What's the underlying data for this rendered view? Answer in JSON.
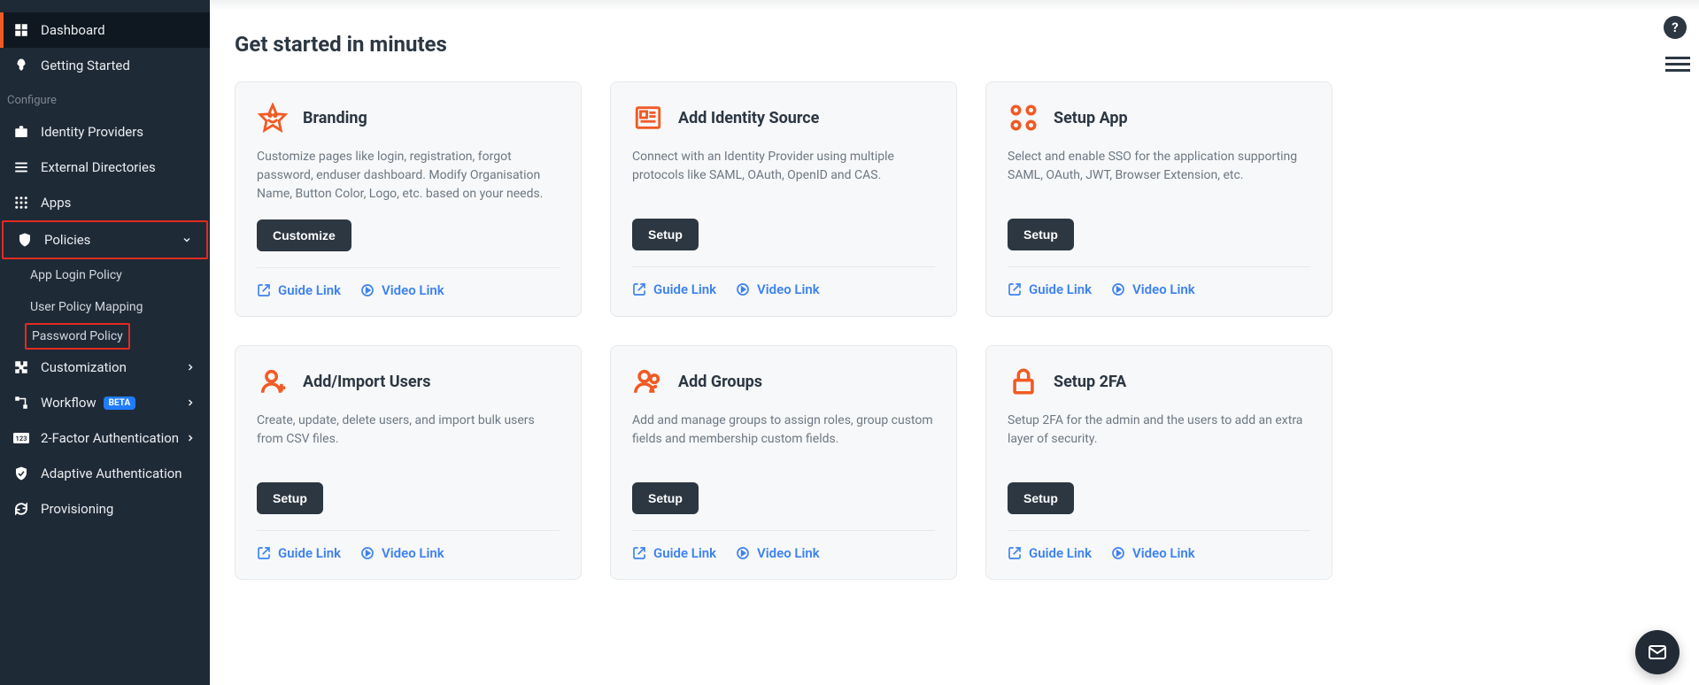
{
  "sidebar": {
    "top": [
      {
        "label": "Dashboard",
        "icon": "dashboard",
        "active": true
      },
      {
        "label": "Getting Started",
        "icon": "rocket"
      }
    ],
    "section_label": "Configure",
    "items": [
      {
        "label": "Identity Providers",
        "icon": "briefcase"
      },
      {
        "label": "External Directories",
        "icon": "list"
      },
      {
        "label": "Apps",
        "icon": "grid"
      },
      {
        "label": "Policies",
        "icon": "shield",
        "expandable": true,
        "outlined": true,
        "children": [
          {
            "label": "App Login Policy"
          },
          {
            "label": "User Policy Mapping"
          },
          {
            "label": "Password Policy",
            "highlighted": true
          }
        ]
      },
      {
        "label": "Customization",
        "icon": "puzzle",
        "expandable": true
      },
      {
        "label": "Workflow",
        "icon": "workflow",
        "badge": "BETA",
        "expandable": true
      },
      {
        "label": "2-Factor Authentication",
        "icon": "digits",
        "expandable": true
      },
      {
        "label": "Adaptive Authentication",
        "icon": "shield-check"
      },
      {
        "label": "Provisioning",
        "icon": "sync"
      }
    ]
  },
  "page": {
    "title": "Get started in minutes",
    "guide_link_label": "Guide Link",
    "video_link_label": "Video Link",
    "cards": [
      {
        "title": "Branding",
        "desc": "Customize pages like login, registration, forgot password, enduser dashboard. Modify Organisation Name, Button Color, Logo, etc. based on your needs.",
        "button": "Customize",
        "icon": "star"
      },
      {
        "title": "Add Identity Source",
        "desc": "Connect with an Identity Provider using multiple protocols like SAML, OAuth, OpenID and CAS.",
        "button": "Setup",
        "icon": "id-card"
      },
      {
        "title": "Setup App",
        "desc": "Select and enable SSO for the application supporting SAML, OAuth, JWT, Browser Extension, etc.",
        "button": "Setup",
        "icon": "apps"
      },
      {
        "title": "Add/Import Users",
        "desc": "Create, update, delete users, and import bulk users from CSV files.",
        "button": "Setup",
        "icon": "user-plus"
      },
      {
        "title": "Add Groups",
        "desc": "Add and manage groups to assign roles, group custom fields and membership custom fields.",
        "button": "Setup",
        "icon": "group"
      },
      {
        "title": "Setup 2FA",
        "desc": "Setup 2FA for the admin and the users to add an extra layer of security.",
        "button": "Setup",
        "icon": "lock"
      }
    ]
  },
  "help_label": "?"
}
